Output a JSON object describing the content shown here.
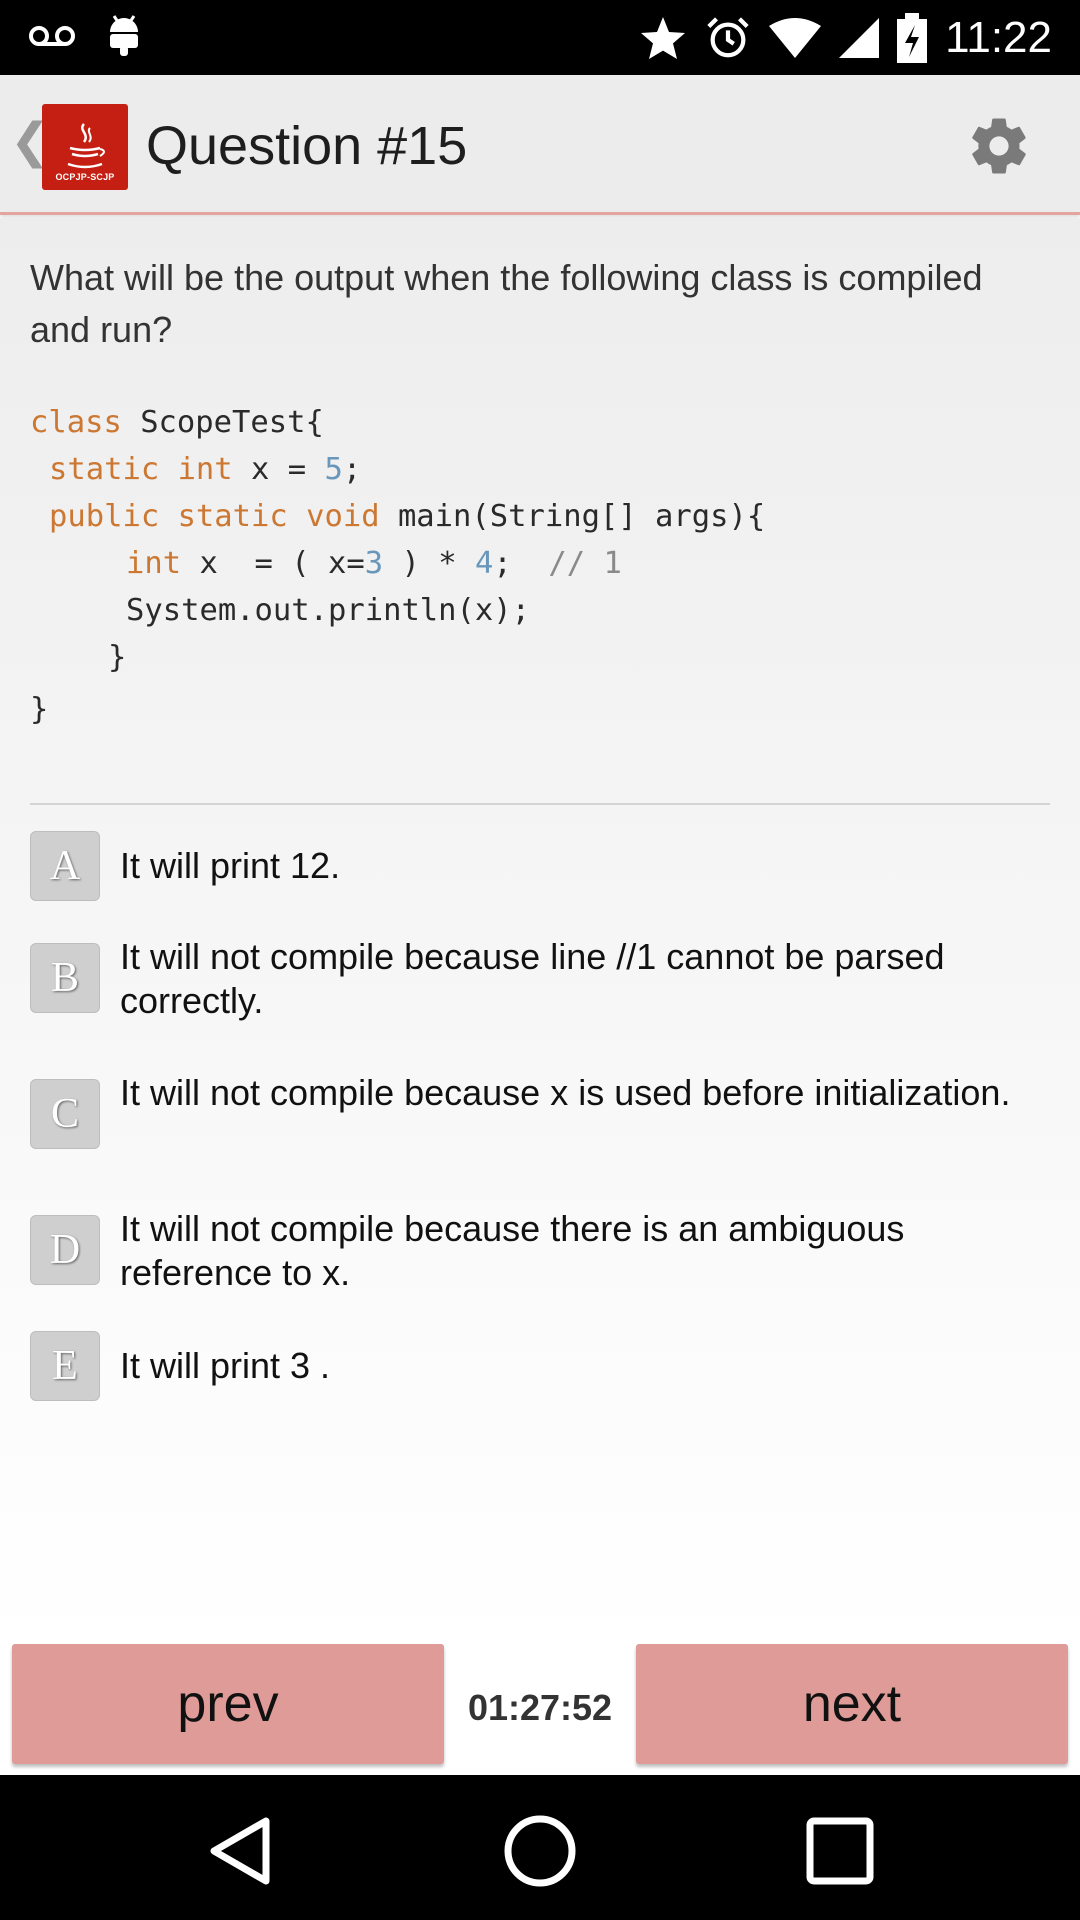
{
  "status_bar": {
    "time": "11:22",
    "left_icons": [
      "voicemail-icon",
      "android-icon"
    ],
    "right_icons": [
      "star-icon",
      "alarm-icon",
      "wifi-icon",
      "cell-signal-icon",
      "battery-charging-icon"
    ]
  },
  "action_bar": {
    "title": "Question #15",
    "logo_text": "OCPJP-SCJP",
    "back_icon": "chevron-left-icon",
    "settings_icon": "gear-icon"
  },
  "question": {
    "text": "What will be the output when the following class is compiled and run?",
    "code": {
      "l1_kw": "class",
      "l1_rest": " ScopeTest{",
      "l2_kw1": "static",
      "l2_kw2": "int",
      "l2_mid": " x = ",
      "l2_num": "5",
      "l2_end": ";",
      "l3_kw1": "public",
      "l3_kw2": "static",
      "l3_kw3": "void",
      "l3_rest": " main(String[] args){",
      "l4_kw": "int",
      "l4_a": " x  = ( x=",
      "l4_num1": "3",
      "l4_b": " ) * ",
      "l4_num2": "4",
      "l4_c": ";  ",
      "l4_comment": "// 1",
      "l5": "System.out.println(x);",
      "l6": "}",
      "l7": "}"
    }
  },
  "options": [
    {
      "letter": "A",
      "text": "It will print 12."
    },
    {
      "letter": "B",
      "text": "It will not compile because line //1 cannot be parsed correctly."
    },
    {
      "letter": "C",
      "text": "It will not compile because x is used before initialization."
    },
    {
      "letter": "D",
      "text": "It will not compile because there is an ambiguous reference to x."
    },
    {
      "letter": "E",
      "text": "It will print 3 ."
    }
  ],
  "bottom": {
    "prev_label": "prev",
    "next_label": "next",
    "timer": "01:27:52"
  },
  "nav_bar": {
    "icons": [
      "back-triangle-icon",
      "home-circle-icon",
      "recents-square-icon"
    ]
  },
  "colors": {
    "accent": "#df9b97",
    "logo_red": "#c41f12",
    "code_keyword": "#cc7832",
    "code_number": "#6897bb"
  }
}
